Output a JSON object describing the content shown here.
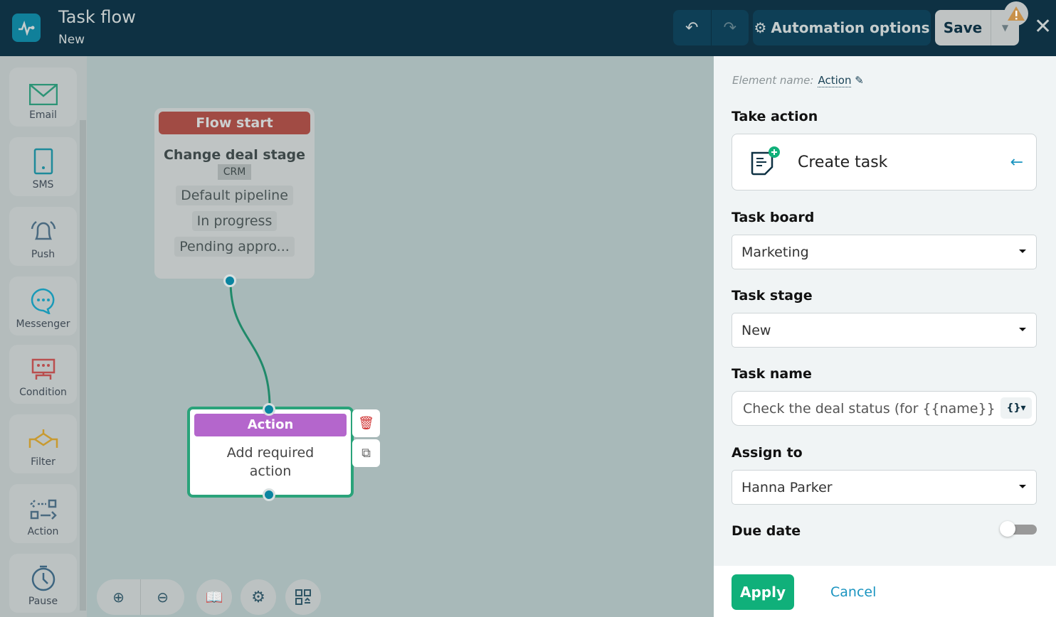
{
  "header": {
    "title": "Task flow",
    "subtitle": "New",
    "automation_label": "Automation options",
    "save_label": "Save"
  },
  "sidebar": {
    "items": [
      {
        "label": "Email"
      },
      {
        "label": "SMS"
      },
      {
        "label": "Push"
      },
      {
        "label": "Messenger"
      },
      {
        "label": "Condition"
      },
      {
        "label": "Filter"
      },
      {
        "label": "Action"
      },
      {
        "label": "Pause"
      }
    ]
  },
  "canvas": {
    "start_node": {
      "header": "Flow start",
      "title": "Change deal stage",
      "badge": "CRM",
      "chips": [
        "Default pipeline",
        "In progress",
        "Pending appro..."
      ]
    },
    "action_node": {
      "header": "Action",
      "body": "Add required action"
    }
  },
  "panel": {
    "element_name_label": "Element name:",
    "element_name": "Action",
    "take_action_label": "Take action",
    "take_action_value": "Create task",
    "task_board_label": "Task board",
    "task_board_value": "Marketing",
    "task_stage_label": "Task stage",
    "task_stage_value": "New",
    "task_name_label": "Task name",
    "task_name_value": "Check the deal status (for {{name}} )",
    "assign_label": "Assign to",
    "assign_value": "Hanna Parker",
    "due_date_label": "Due date",
    "due_date_enabled": false,
    "apply_label": "Apply",
    "cancel_label": "Cancel"
  },
  "colors": {
    "header": "#0e3143",
    "canvas": "#a8b9b9",
    "accent": "#10b07a",
    "start": "#a14b44",
    "action": "#b466cc"
  }
}
